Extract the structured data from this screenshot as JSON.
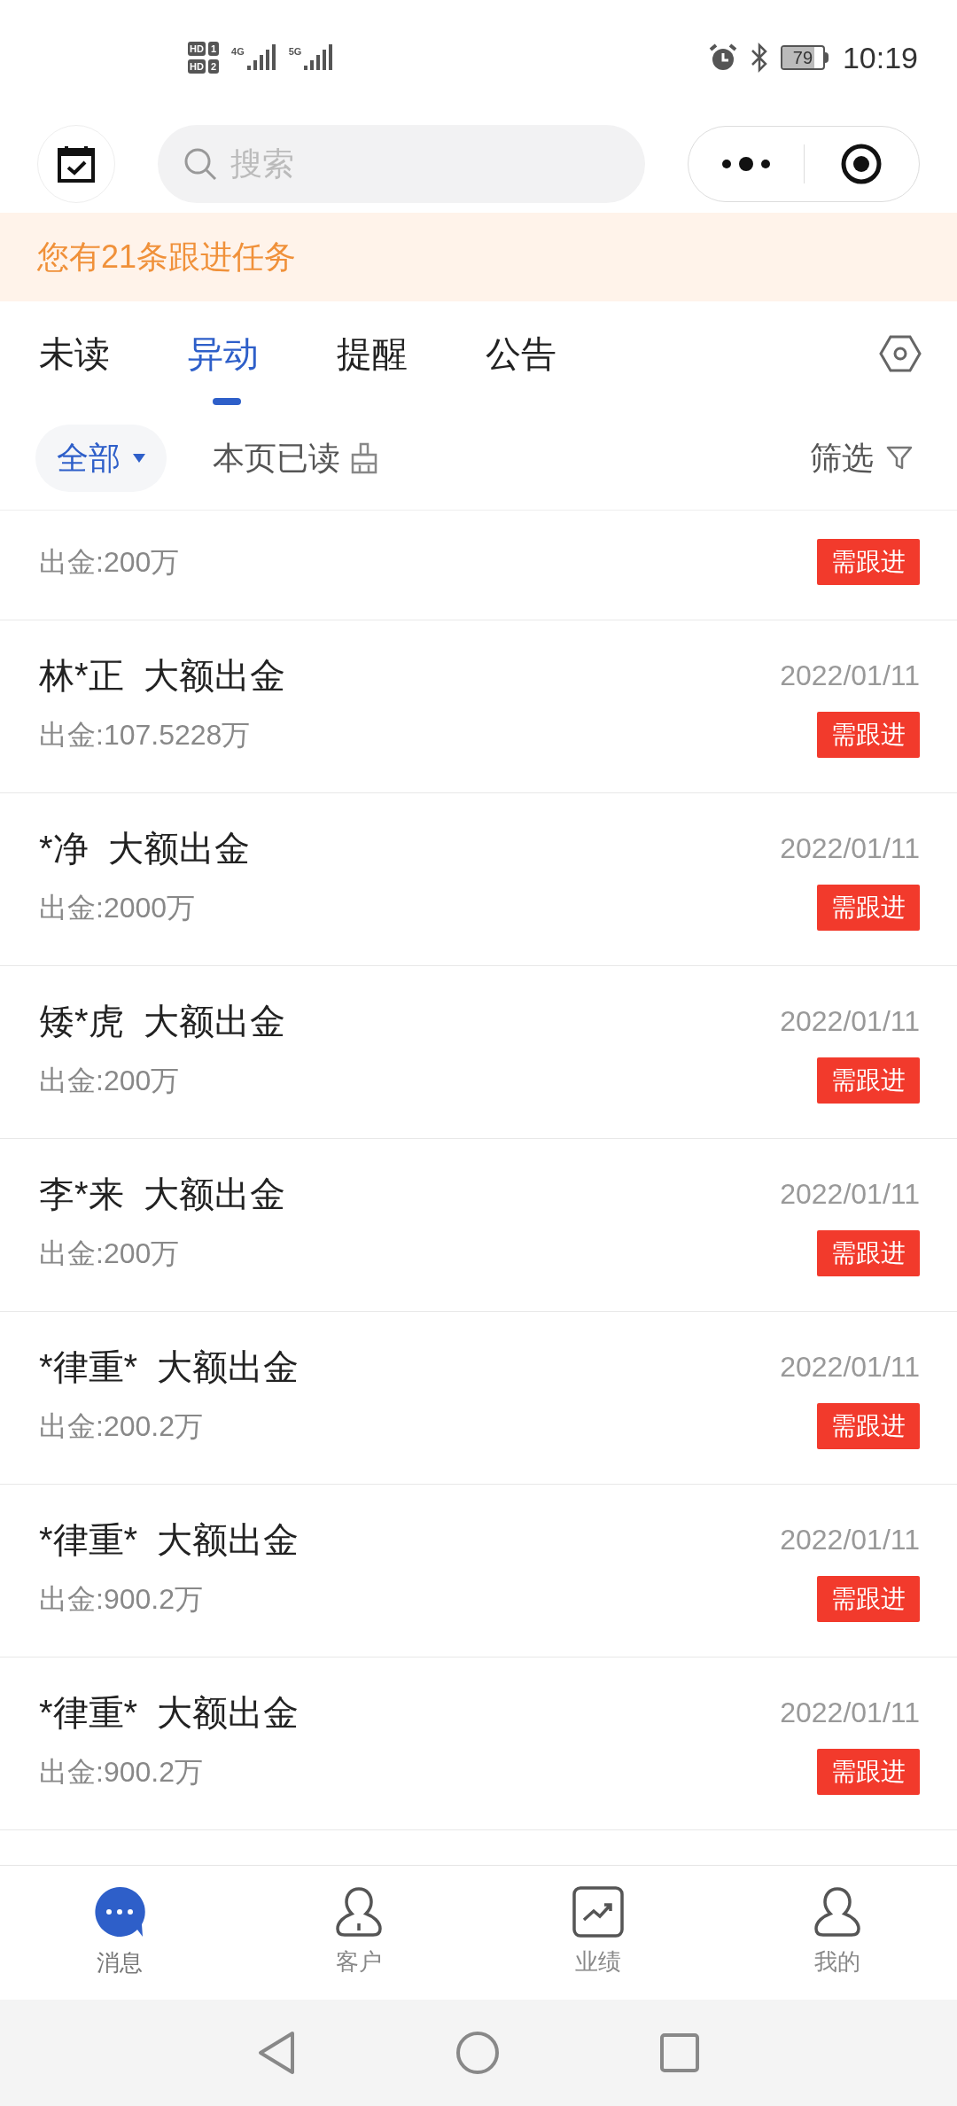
{
  "status_bar": {
    "sims": [
      {
        "label": "HD",
        "slot": "1"
      },
      {
        "label": "HD",
        "slot": "2"
      }
    ],
    "networks": [
      "4G",
      "5G"
    ],
    "battery": "79",
    "time": "10:19"
  },
  "header": {
    "search": {
      "placeholder": "搜索"
    }
  },
  "banner": "您有21条跟进任务",
  "tabs": [
    {
      "label": "未读",
      "selected": false
    },
    {
      "label": "异动",
      "selected": true
    },
    {
      "label": "提醒",
      "selected": false
    },
    {
      "label": "公告",
      "selected": false
    }
  ],
  "filter_bar": {
    "scope": "全部",
    "mark_read": "本页已读",
    "filter": "筛选"
  },
  "items": [
    {
      "amount": "出金:200万",
      "badge": "需跟进"
    },
    {
      "title": "林*正  大额出金",
      "date": "2022/01/11",
      "amount": "出金:107.5228万",
      "badge": "需跟进"
    },
    {
      "title": "*净  大额出金",
      "date": "2022/01/11",
      "amount": "出金:2000万",
      "badge": "需跟进"
    },
    {
      "title": "矮*虎  大额出金",
      "date": "2022/01/11",
      "amount": "出金:200万",
      "badge": "需跟进"
    },
    {
      "title": "李*来  大额出金",
      "date": "2022/01/11",
      "amount": "出金:200万",
      "badge": "需跟进"
    },
    {
      "title": "*律重*  大额出金",
      "date": "2022/01/11",
      "amount": "出金:200.2万",
      "badge": "需跟进"
    },
    {
      "title": "*律重*  大额出金",
      "date": "2022/01/11",
      "amount": "出金:900.2万",
      "badge": "需跟进"
    },
    {
      "title": "*律重*  大额出金",
      "date": "2022/01/11",
      "amount": "出金:900.2万",
      "badge": "需跟进"
    }
  ],
  "bottom_nav": [
    {
      "label": "消息",
      "kind": "chat",
      "selected": true
    },
    {
      "label": "客户",
      "kind": "contact",
      "selected": false
    },
    {
      "label": "业绩",
      "kind": "chart",
      "selected": false
    },
    {
      "label": "我的",
      "kind": "profile",
      "selected": false
    }
  ]
}
